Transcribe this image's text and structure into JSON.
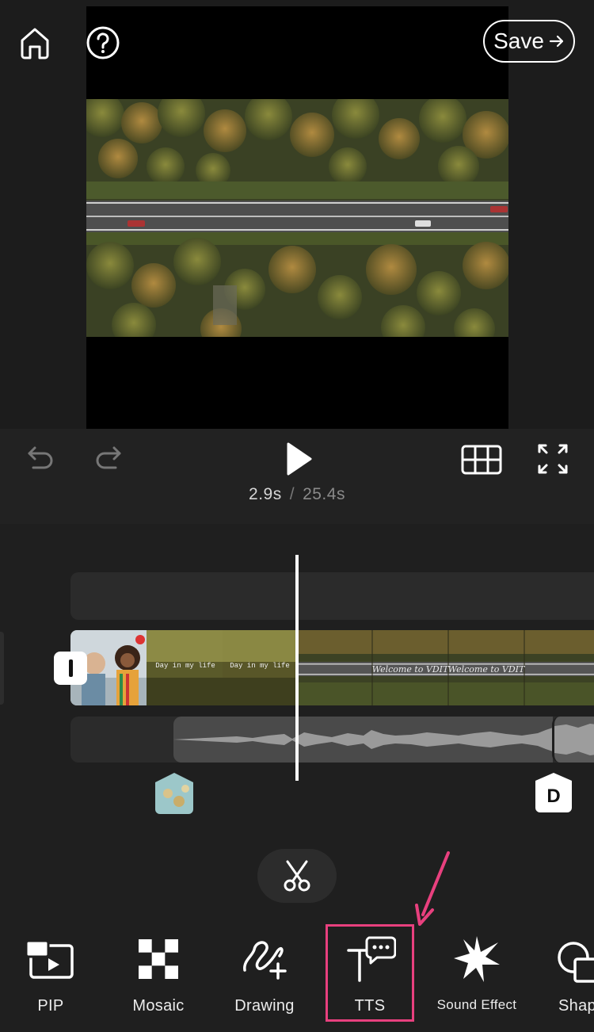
{
  "header": {
    "save_label": "Save"
  },
  "playback": {
    "current_time": "2.9s",
    "separator": "/",
    "total_time": "25.4s"
  },
  "timeline": {
    "clip_caption_1": "Day in my life",
    "clip_caption_2": "Day in my life",
    "clip_caption_3": "Welcome to VDIT",
    "clip_caption_4": "Welcome to VDIT",
    "end_marker_label": "D"
  },
  "toolbar": {
    "items": [
      {
        "label": "PIP",
        "icon": "pip-icon"
      },
      {
        "label": "Mosaic",
        "icon": "mosaic-icon"
      },
      {
        "label": "Drawing",
        "icon": "drawing-icon"
      },
      {
        "label": "TTS",
        "icon": "tts-icon",
        "highlighted": true
      },
      {
        "label": "Sound Effect",
        "icon": "sound-effect-icon"
      },
      {
        "label": "Shap",
        "icon": "shape-icon"
      }
    ]
  },
  "colors": {
    "background": "#1f1f1f",
    "highlight": "#e8407e",
    "track": "#2b2b2b"
  }
}
